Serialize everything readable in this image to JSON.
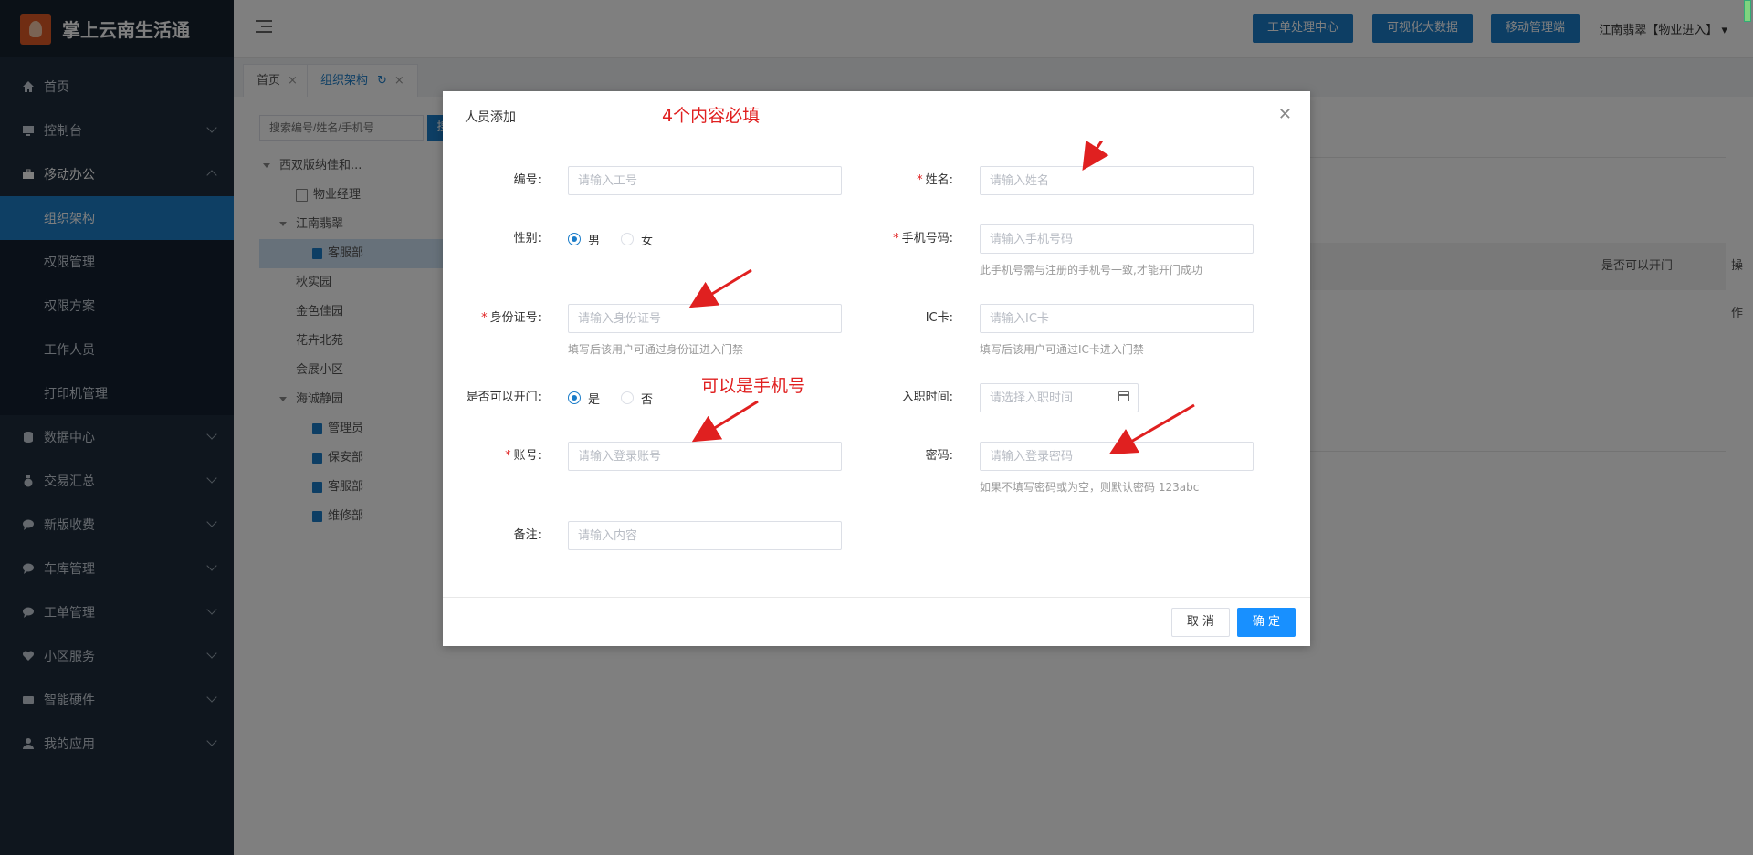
{
  "app": {
    "title": "掌上云南生活通"
  },
  "sidebar": {
    "items": [
      {
        "label": "首页",
        "icon": "home-icon"
      },
      {
        "label": "控制台",
        "icon": "monitor-icon"
      },
      {
        "label": "移动办公",
        "icon": "briefcase-icon"
      },
      {
        "label": "数据中心",
        "icon": "database-icon"
      },
      {
        "label": "交易汇总",
        "icon": "money-bag-icon"
      },
      {
        "label": "新版收费",
        "icon": "chat-icon"
      },
      {
        "label": "车库管理",
        "icon": "chat-icon"
      },
      {
        "label": "工单管理",
        "icon": "chat-icon"
      },
      {
        "label": "小区服务",
        "icon": "heart-icon"
      },
      {
        "label": "智能硬件",
        "icon": "device-icon"
      },
      {
        "label": "我的应用",
        "icon": "user-icon"
      }
    ],
    "submenu": [
      "组织架构",
      "权限管理",
      "权限方案",
      "工作人员",
      "打印机管理"
    ]
  },
  "header": {
    "buttons": [
      "工单处理中心",
      "可视化大数据",
      "移动管理端"
    ],
    "user": "江南翡翠【物业进入】"
  },
  "tabs": [
    {
      "label": "首页"
    },
    {
      "label": "组织架构"
    }
  ],
  "content": {
    "search_placeholder": "搜索编号/姓名/手机号",
    "search_btn": "搜",
    "tree": [
      "西双版纳佳和...",
      "物业经理",
      "江南翡翠",
      "客服部",
      "秋实园",
      "金色佳园",
      "花卉北苑",
      "会展小区",
      "海诚静园",
      "管理员",
      "保安部",
      "客服部",
      "维修部"
    ],
    "table_cols": [
      "是否可以开门",
      "操作"
    ]
  },
  "modal": {
    "title": "人员添加",
    "note_required": "4个内容必填",
    "note_phone": "可以是手机号",
    "fields": {
      "code": {
        "label": "编号:",
        "placeholder": "请输入工号"
      },
      "name": {
        "label": "姓名:",
        "placeholder": "请输入姓名"
      },
      "gender": {
        "label": "性别:",
        "male": "男",
        "female": "女"
      },
      "phone": {
        "label": "手机号码:",
        "placeholder": "请输入手机号码",
        "hint": "此手机号需与注册的手机号一致,才能开门成功"
      },
      "idcard": {
        "label": "身份证号:",
        "placeholder": "请输入身份证号",
        "hint": "填写后该用户可通过身份证进入门禁"
      },
      "ic": {
        "label": "IC卡:",
        "placeholder": "请输入IC卡",
        "hint": "填写后该用户可通过IC卡进入门禁"
      },
      "door": {
        "label": "是否可以开门:",
        "yes": "是",
        "no": "否"
      },
      "hire": {
        "label": "入职时间:",
        "placeholder": "请选择入职时间"
      },
      "account": {
        "label": "账号:",
        "placeholder": "请输入登录账号"
      },
      "password": {
        "label": "密码:",
        "placeholder": "请输入登录密码",
        "hint": "如果不填写密码或为空，则默认密码 123abc"
      },
      "remark": {
        "label": "备注:",
        "placeholder": "请输入内容"
      }
    },
    "cancel": "取 消",
    "ok": "确 定"
  }
}
